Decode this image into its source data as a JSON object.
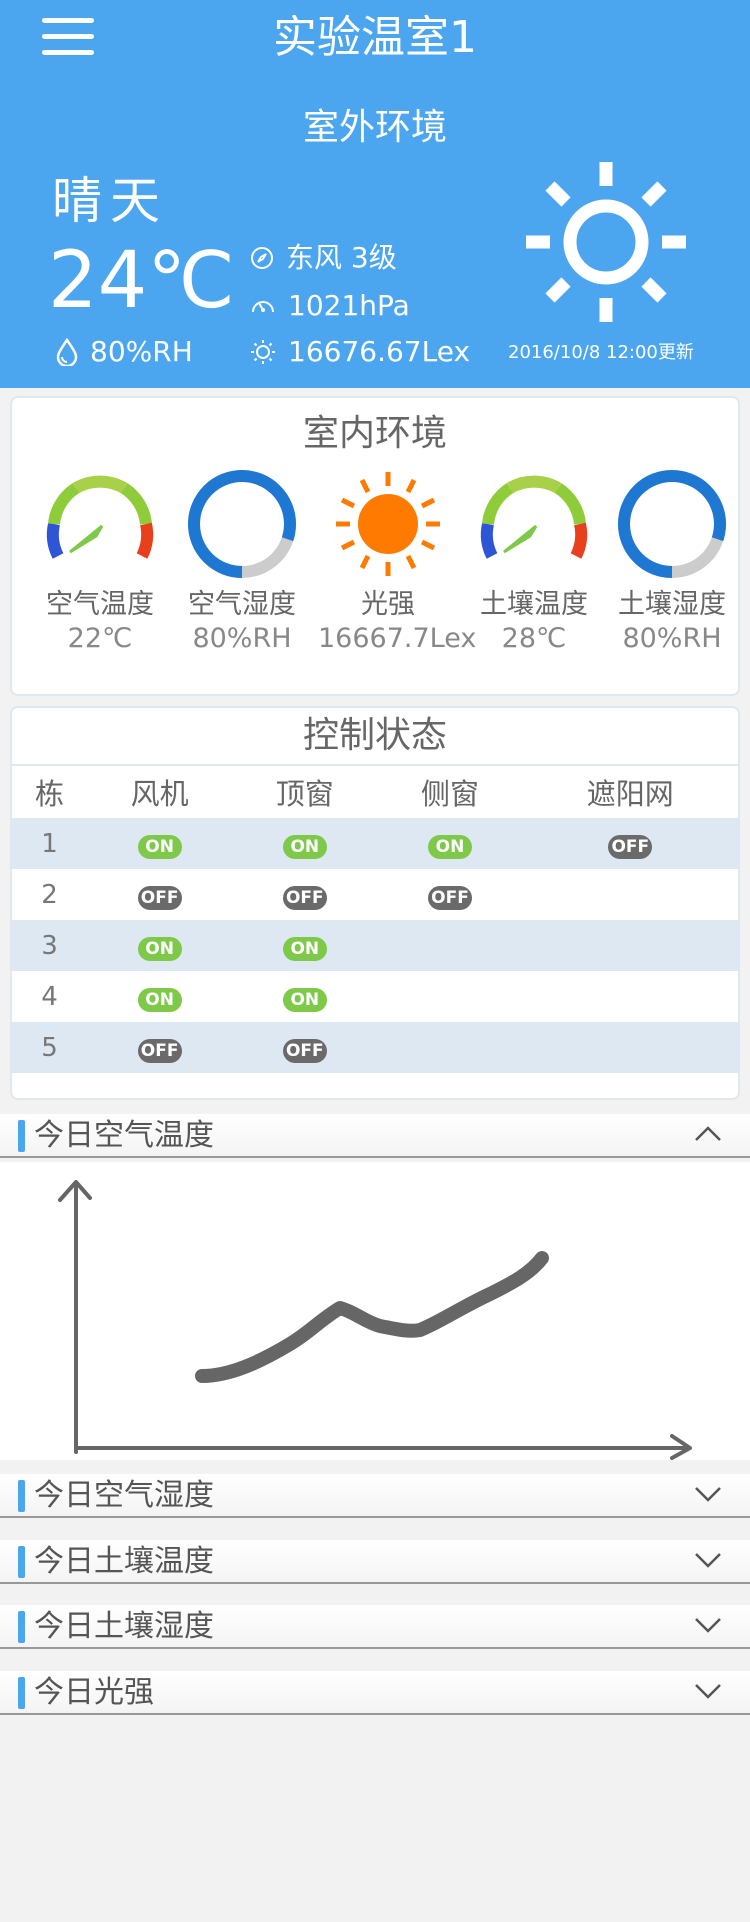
{
  "header": {
    "title": "实验温室1",
    "menu_icon": "hamburger-menu-icon",
    "outdoor": {
      "title": "室外环境",
      "condition": "晴天",
      "temperature": "24℃",
      "humidity": "80%RH",
      "wind": "东风 3级",
      "pressure": "1021hPa",
      "light": "16676.67Lex",
      "update_time": "2016/10/8 12:00更新",
      "weather_icon": "sunny-icon"
    }
  },
  "indoor": {
    "title": "室内环境",
    "items": [
      {
        "label": "空气温度",
        "value": "22℃",
        "icon": "thermometer-gauge-icon"
      },
      {
        "label": "空气湿度",
        "value": "80%RH",
        "icon": "humidity-ring-icon",
        "level": 0.8
      },
      {
        "label": "光强",
        "value": "16667.7Lex",
        "icon": "sun-icon"
      },
      {
        "label": "土壤温度",
        "value": "28℃",
        "icon": "thermometer-gauge-icon"
      },
      {
        "label": "土壤湿度",
        "value": "80%RH",
        "icon": "humidity-ring-icon",
        "level": 0.8
      }
    ]
  },
  "control": {
    "title": "控制状态",
    "columns": [
      "栋",
      "风机",
      "顶窗",
      "侧窗",
      "遮阳网"
    ],
    "rows": [
      {
        "id": "1",
        "fan": "ON",
        "top_window": "ON",
        "side_window": "ON",
        "shade": "OFF"
      },
      {
        "id": "2",
        "fan": "OFF",
        "top_window": "OFF",
        "side_window": "OFF",
        "shade": ""
      },
      {
        "id": "3",
        "fan": "ON",
        "top_window": "ON",
        "side_window": "",
        "shade": ""
      },
      {
        "id": "4",
        "fan": "ON",
        "top_window": "ON",
        "side_window": "",
        "shade": ""
      },
      {
        "id": "5",
        "fan": "OFF",
        "top_window": "OFF",
        "side_window": "",
        "shade": ""
      }
    ]
  },
  "sections": [
    {
      "label": "今日空气温度",
      "expanded": true
    },
    {
      "label": "今日空气湿度",
      "expanded": false
    },
    {
      "label": "今日土壤温度",
      "expanded": false
    },
    {
      "label": "今日土壤湿度",
      "expanded": false
    },
    {
      "label": "今日光强",
      "expanded": false
    }
  ],
  "colors": {
    "header_bg": "#4ba6ef",
    "on": "#7ec84a",
    "off": "#6a6a6a",
    "stripe": "#dde8f3",
    "sun_orange": "#ff7a00",
    "ring_blue": "#1e78d2",
    "ring_gray": "#cccccc"
  }
}
